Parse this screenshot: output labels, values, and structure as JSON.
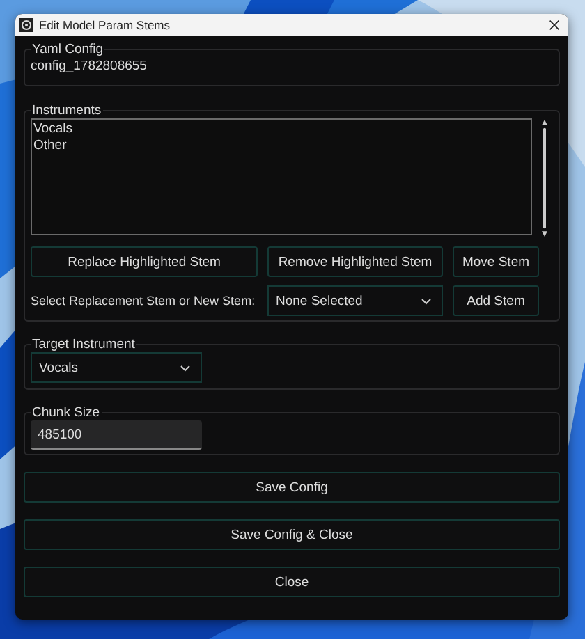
{
  "window": {
    "title": "Edit Model Param Stems"
  },
  "yaml_config": {
    "label": "Yaml Config",
    "value": "config_1782808655"
  },
  "instruments": {
    "label": "Instruments",
    "items": [
      {
        "label": "Vocals",
        "selected": false
      },
      {
        "label": "Other",
        "selected": false
      }
    ],
    "buttons": [
      "Replace Highlighted Stem",
      "Remove Highlighted Stem",
      "Move Stem"
    ],
    "select_label": "Select Replacement Stem or New Stem:",
    "select_value": "None Selected",
    "add_button": "Add Stem"
  },
  "target_instrument": {
    "label": "Target Instrument",
    "value": "Vocals"
  },
  "chunk_size": {
    "label": "Chunk Size",
    "value": "485100"
  },
  "buttons": [
    "Save Config",
    "Save Config & Close",
    "Close"
  ]
}
